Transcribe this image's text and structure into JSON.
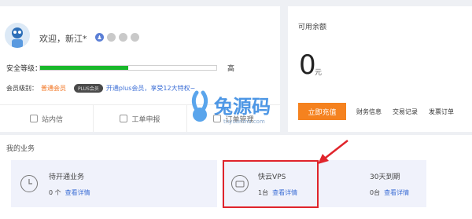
{
  "profile": {
    "welcome": "欢迎，新江*",
    "level_label": "安全等级：",
    "level_value": "高",
    "level_progress": 0.5,
    "member_label": "会员级别：",
    "member_value": "普通会员",
    "plus_badge": "PLUS会员",
    "member_link": "开通plus会员，享受12大特权~"
  },
  "quick_links": [
    {
      "label": "站内信",
      "icon": "mail-icon"
    },
    {
      "label": "工单申报",
      "icon": "ticket-icon"
    },
    {
      "label": "订单管理",
      "icon": "order-icon"
    }
  ],
  "balance": {
    "title": "可用余额",
    "amount": "0",
    "unit": "元",
    "recharge": "立即充值",
    "links": [
      "财务信息",
      "交易记录",
      "发票订单"
    ]
  },
  "business": {
    "title": "我的业务",
    "items": [
      {
        "name": "待开通业务",
        "count": "0 个",
        "link": "查看详情",
        "icon": "clock-icon"
      },
      {
        "name": "快云VPS",
        "count": "1台",
        "link": "查看详情",
        "icon": "cloud-server-icon"
      },
      {
        "name": "30天到期",
        "count": "0台",
        "link": "查看详情",
        "icon": "calendar-icon"
      }
    ]
  },
  "watermark": {
    "text": "兔源码",
    "sub": "tuyuanma.com"
  },
  "colors": {
    "accent": "#f5821f",
    "progress": "#18b82a",
    "link": "#3d6fd6",
    "highlight": "#e0242b"
  }
}
